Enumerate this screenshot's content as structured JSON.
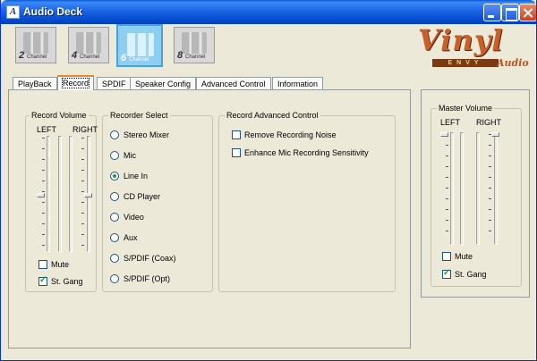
{
  "window": {
    "title": "Audio Deck",
    "app_icon": "A"
  },
  "channels": [
    {
      "num": "2",
      "label": "Channel",
      "active": false
    },
    {
      "num": "4",
      "label": "Channel",
      "active": false
    },
    {
      "num": "6",
      "label": "Channel",
      "active": true
    },
    {
      "num": "8",
      "label": "Channel",
      "active": false
    }
  ],
  "logo": {
    "main": "Vinyl",
    "envy": "ENVY",
    "audio": "Audio"
  },
  "tabs": [
    "PlayBack",
    "Record",
    "SPDIF",
    "Speaker Config",
    "Advanced Control",
    "Information"
  ],
  "active_tab": "Record",
  "record_volume": {
    "title": "Record Volume",
    "left_label": "LEFT",
    "right_label": "RIGHT",
    "mute_label": "Mute",
    "mute_checked": false,
    "stgang_label": "St. Gang",
    "stgang_checked": true
  },
  "recorder_select": {
    "title": "Recorder Select",
    "options": [
      "Stereo Mixer",
      "Mic",
      "Line In",
      "CD Player",
      "Video",
      "Aux",
      "S/PDIF (Coax)",
      "S/PDIF (Opt)"
    ],
    "selected": "Line In"
  },
  "record_advanced": {
    "title": "Record Advanced Control",
    "options": [
      {
        "label": "Remove Recording Noise",
        "checked": false
      },
      {
        "label": "Enhance Mic Recording Sensitivity",
        "checked": false
      }
    ]
  },
  "master_volume": {
    "title": "Master Volume",
    "left_label": "LEFT",
    "right_label": "RIGHT",
    "mute_label": "Mute",
    "mute_checked": false,
    "stgang_label": "St. Gang",
    "stgang_checked": true
  }
}
